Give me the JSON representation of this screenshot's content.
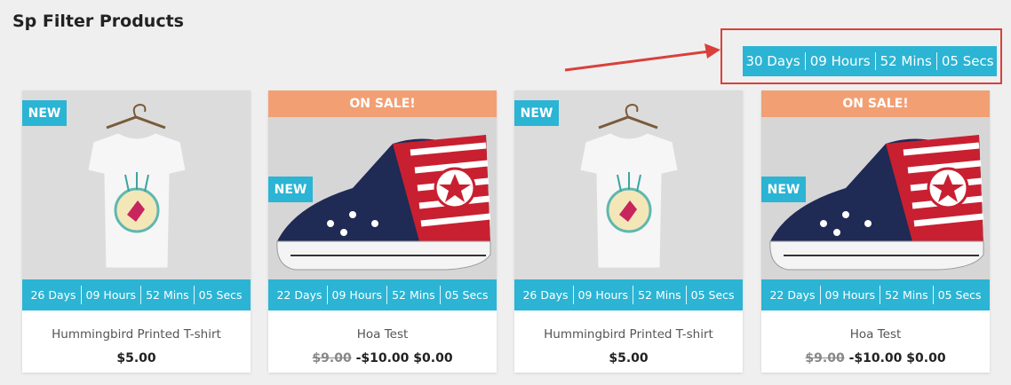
{
  "section_title": "Sp Filter Products",
  "main_countdown": {
    "days": "30 Days",
    "hours": "09 Hours",
    "mins": "52 Mins",
    "secs": "05 Secs"
  },
  "colors": {
    "accent": "#2bb4d4",
    "sale": "#f29f74",
    "annotation": "#d9403b"
  },
  "products": [
    {
      "name": "Hummingbird Printed T-shirt",
      "image_icon": "tshirt-icon",
      "badges": {
        "new": "NEW"
      },
      "countdown": {
        "days": "26 Days",
        "hours": "09 Hours",
        "mins": "52 Mins",
        "secs": "05 Secs"
      },
      "price": "$5.00"
    },
    {
      "name": "Hoa Test",
      "image_icon": "sneaker-icon",
      "badges": {
        "sale": "ON SALE!",
        "new": "NEW"
      },
      "countdown": {
        "days": "22 Days",
        "hours": "09 Hours",
        "mins": "52 Mins",
        "secs": "05 Secs"
      },
      "old_price": "$9.00",
      "discount": "-$10.00",
      "price": "$0.00"
    },
    {
      "name": "Hummingbird Printed T-shirt",
      "image_icon": "tshirt-icon",
      "badges": {
        "new": "NEW"
      },
      "countdown": {
        "days": "26 Days",
        "hours": "09 Hours",
        "mins": "52 Mins",
        "secs": "05 Secs"
      },
      "price": "$5.00"
    },
    {
      "name": "Hoa Test",
      "image_icon": "sneaker-icon",
      "badges": {
        "sale": "ON SALE!",
        "new": "NEW"
      },
      "countdown": {
        "days": "22 Days",
        "hours": "09 Hours",
        "mins": "52 Mins",
        "secs": "05 Secs"
      },
      "old_price": "$9.00",
      "discount": "-$10.00",
      "price": "$0.00"
    }
  ]
}
